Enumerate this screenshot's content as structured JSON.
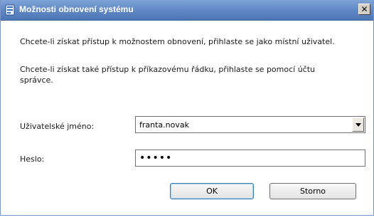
{
  "window": {
    "title": "Možnosti obnovení systému",
    "icon": "recovery-icon",
    "close_glyph": "✕"
  },
  "message": {
    "line1": "Chcete-li získat přístup k možnostem obnovení, přihlaste se jako místní uživatel.",
    "line2": "Chcete-li získat také přístup k příkazovému řádku, přihlaste se pomocí účtu správce."
  },
  "form": {
    "username_label": "Uživatelské jméno:",
    "username_value": "franta.novak",
    "password_label": "Heslo:",
    "password_value": "•••••"
  },
  "buttons": {
    "ok": "OK",
    "cancel": "Storno"
  }
}
